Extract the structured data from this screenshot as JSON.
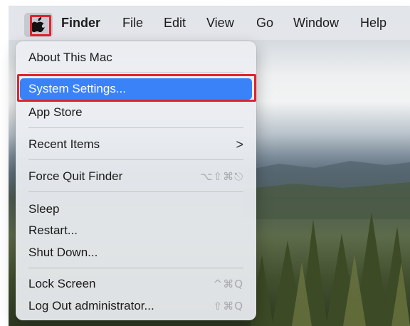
{
  "menubar": {
    "apple_icon": "apple-logo-icon",
    "items": [
      "Finder",
      "File",
      "Edit",
      "View",
      "Go",
      "Window",
      "Help"
    ]
  },
  "apple_menu": {
    "about": "About This Mac",
    "system_settings": "System Settings...",
    "app_store": "App Store",
    "recent_items": "Recent Items",
    "recent_items_arrow": ">",
    "force_quit": "Force Quit Finder",
    "force_quit_shortcut": "⌥⇧⌘⎋",
    "sleep": "Sleep",
    "restart": "Restart...",
    "shut_down": "Shut Down...",
    "lock_screen": "Lock Screen",
    "lock_screen_shortcut": "^⌘Q",
    "log_out": "Log Out administrator...",
    "log_out_shortcut": "⇧⌘Q"
  },
  "colors": {
    "selection": "#3a82f7",
    "highlight_box": "#e0242f"
  }
}
